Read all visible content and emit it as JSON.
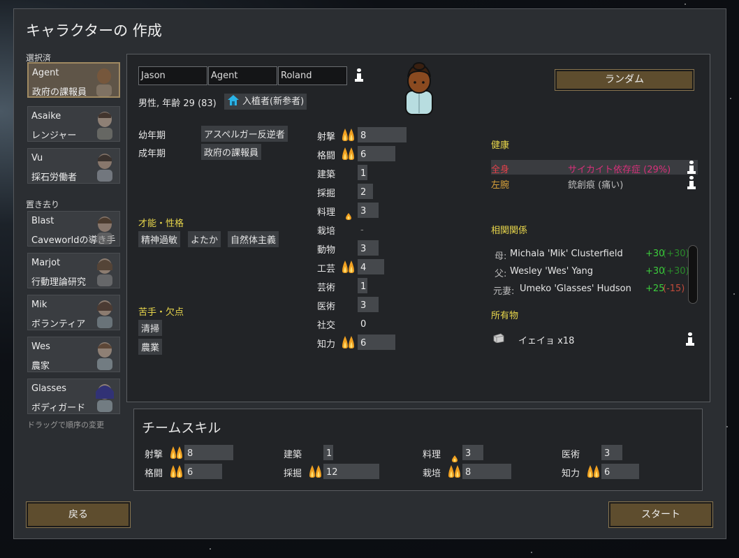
{
  "window_title": "キャラクターの 作成",
  "sections": {
    "selected": "選択済",
    "left_behind": "置き去り"
  },
  "pawns_selected": [
    {
      "name": "Agent",
      "role": "政府の課報員"
    },
    {
      "name": "Asaike",
      "role": "レンジャー"
    },
    {
      "name": "Vu",
      "role": "採石労働者"
    }
  ],
  "pawns_left": [
    {
      "name": "Blast",
      "role": "Caveworldの導き手"
    },
    {
      "name": "Marjot",
      "role": "行動理論研究"
    },
    {
      "name": "Mik",
      "role": "ボランティア"
    },
    {
      "name": "Wes",
      "role": "農家"
    },
    {
      "name": "Glasses",
      "role": "ボディガード"
    }
  ],
  "drag_hint": "ドラッグで順序の変更",
  "character": {
    "first": "Jason",
    "nick": "Agent",
    "last": "Roland",
    "gender_age": "男性, 年齢 29 (83)",
    "faction_tag": "入植者(新参者)",
    "random_button": "ランダム",
    "childhood_label": "幼年期",
    "childhood": "アスペルガー反逆者",
    "adulthood_label": "成年期",
    "adulthood": "政府の課報員",
    "traits_header": "才能・性格",
    "traits": [
      "精神過敏",
      "よたか",
      "自然体主義"
    ],
    "incapable_header": "苦手・欠点",
    "incapable": [
      "清掃",
      "農業"
    ]
  },
  "skills": [
    {
      "name": "射撃",
      "value": "8",
      "passion": 2
    },
    {
      "name": "格闘",
      "value": "6",
      "passion": 2
    },
    {
      "name": "建築",
      "value": "1",
      "passion": 0
    },
    {
      "name": "採掘",
      "value": "2",
      "passion": 0
    },
    {
      "name": "料理",
      "value": "3",
      "passion": 1
    },
    {
      "name": "栽培",
      "value": "-",
      "passion": 0
    },
    {
      "name": "動物",
      "value": "3",
      "passion": 0
    },
    {
      "name": "工芸",
      "value": "4",
      "passion": 2
    },
    {
      "name": "芸術",
      "value": "1",
      "passion": 0
    },
    {
      "name": "医術",
      "value": "3",
      "passion": 0
    },
    {
      "name": "社交",
      "value": "0",
      "passion": 0
    },
    {
      "name": "知力",
      "value": "6",
      "passion": 2
    }
  ],
  "health": {
    "header": "健康",
    "rows": [
      {
        "part": "全身",
        "condition": "サイカイト依存症 (29%)",
        "part_color": "#e0404a",
        "cond_color": "#d8307a"
      },
      {
        "part": "左腕",
        "condition": "銃創痕 (痛い)",
        "part_color": "#d9a23a",
        "cond_color": "#bdbdbd"
      }
    ]
  },
  "relations": {
    "header": "相関関係",
    "rows": [
      {
        "rel": "母:",
        "name": "Michala 'Mik' Clusterfield",
        "op": "+30",
        "op2": "(+30)"
      },
      {
        "rel": "父:",
        "name": "Wesley 'Wes' Yang",
        "op": "+30",
        "op2": "(+30)"
      },
      {
        "rel": "元妻:",
        "name": "Umeko 'Glasses' Hudson",
        "op": "+25",
        "op2": "(-15)"
      }
    ]
  },
  "possessions": {
    "header": "所有物",
    "item": "イェイョ x18"
  },
  "team": {
    "title": "チームスキル",
    "skills": [
      {
        "name": "射撃",
        "value": "8",
        "passion": 2
      },
      {
        "name": "格闘",
        "value": "6",
        "passion": 2
      },
      {
        "name": "建築",
        "value": "1",
        "passion": 0
      },
      {
        "name": "採掘",
        "value": "12",
        "passion": 2
      },
      {
        "name": "料理",
        "value": "3",
        "passion": 1
      },
      {
        "name": "栽培",
        "value": "8",
        "passion": 2
      },
      {
        "name": "医術",
        "value": "3",
        "passion": 0
      },
      {
        "name": "知力",
        "value": "6",
        "passion": 2
      }
    ]
  },
  "buttons": {
    "back": "戻る",
    "start": "スタート"
  },
  "colors": {
    "positive": "#3ccc3c",
    "negative": "#c04a3a",
    "accent": "#e8d64b",
    "button": "#5e4d2e"
  }
}
